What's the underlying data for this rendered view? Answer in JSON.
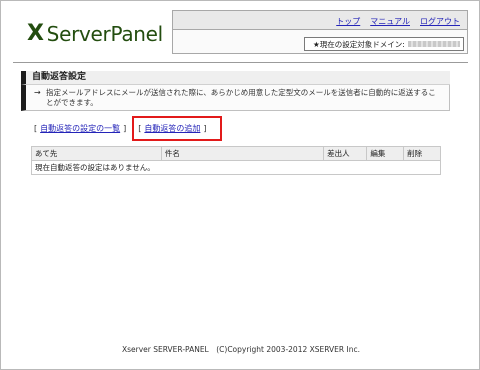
{
  "header": {
    "logo_mark": "X",
    "logo_text": "ServerPanel",
    "nav": {
      "top": "トップ",
      "manual": "マニュアル",
      "logout": "ログアウト"
    },
    "domain_label": "★現在の設定対象ドメイン:"
  },
  "page": {
    "title": "自動返答設定",
    "description_arrow": "→",
    "description": "指定メールアドレスにメールが送信された際に、あらかじめ用意した定型文のメールを送信者に自動的に返送することができます。"
  },
  "links": {
    "open_bracket": "[",
    "close_bracket": "]",
    "list_label": "自動返答の設定の一覧",
    "add_label": "自動返答の追加"
  },
  "table": {
    "columns": [
      "あて先",
      "件名",
      "差出人",
      "編集",
      "削除"
    ],
    "empty_message": "現在自動返答の設定はありません。"
  },
  "footer": {
    "text": "Xserver SERVER-PANEL　(C)Copyright 2003-2012 XSERVER Inc."
  },
  "colors": {
    "brand_green": "#234d0f",
    "link_blue": "#2424b8",
    "highlight_red": "#e21a1a"
  }
}
